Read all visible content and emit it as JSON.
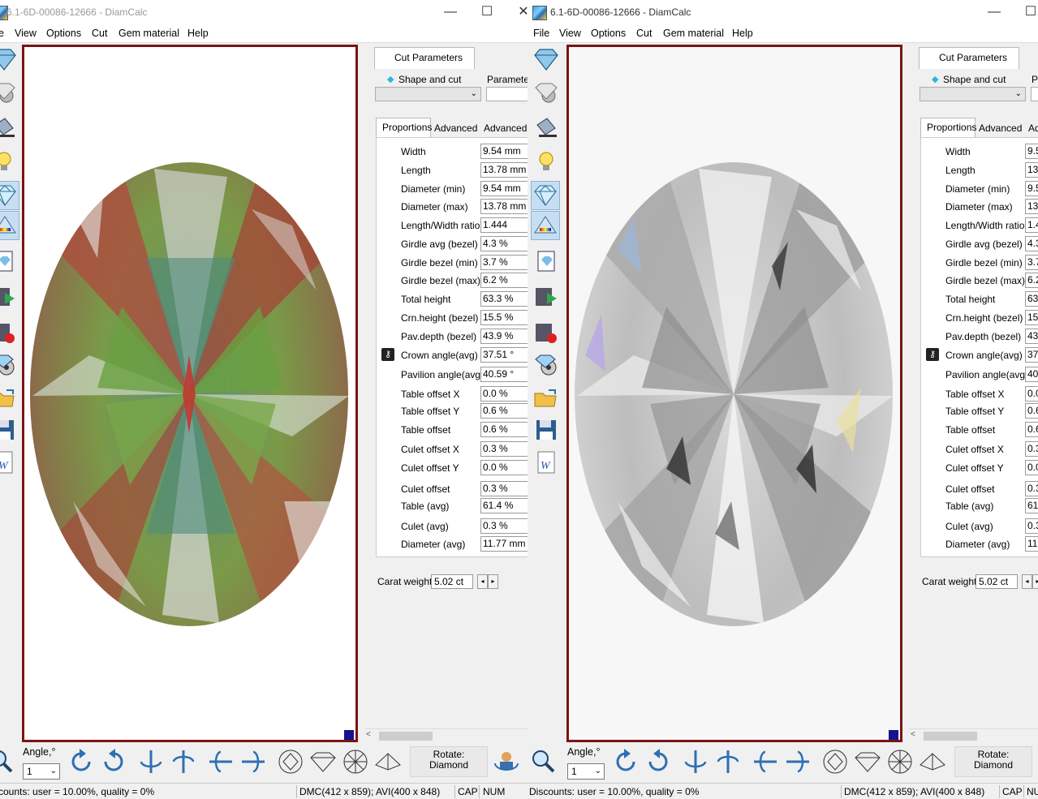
{
  "left_window": {
    "title": "6.1-6D-00086-12666 - DiamCalc",
    "menu": [
      "e",
      "View",
      "Options",
      "Cut",
      "Gem material",
      "Help"
    ],
    "panel": {
      "cut_parameters_tab": "Cut Parameters",
      "shape_and_cut_label": "Shape and cut",
      "parameters_label": "Parameter",
      "subtabs": [
        "Proportions",
        "Advanced",
        "Advanced"
      ],
      "rows": [
        {
          "label": "Width",
          "value": "9.54 mm"
        },
        {
          "label": "Length",
          "value": "13.78 mm"
        },
        {
          "label": "Diameter (min)",
          "value": "9.54 mm"
        },
        {
          "label": "Diameter (max)",
          "value": "13.78 mm"
        },
        {
          "label": "Length/Width ratio",
          "value": "1.444"
        },
        {
          "label": "Girdle avg (bezel)",
          "value": "4.3 %"
        },
        {
          "label": "Girdle bezel (min)",
          "value": "3.7 %"
        },
        {
          "label": "Girdle bezel (max)",
          "value": "6.2 %"
        },
        {
          "label": "Total height",
          "value": "63.3 %"
        },
        {
          "label": "Crn.height (bezel)",
          "value": "15.5 %"
        },
        {
          "label": "Pav.depth (bezel)",
          "value": "43.9 %"
        },
        {
          "label": "Crown angle(avg)",
          "value": "37.51 °"
        },
        {
          "label": "Pavilion angle(avg)",
          "value": "40.59 °"
        },
        {
          "label": "Table offset X",
          "value": "0.0 %"
        },
        {
          "label": "Table offset Y",
          "value": "0.6 %"
        },
        {
          "label": "Table offset",
          "value": "0.6 %"
        },
        {
          "label": "Culet offset X",
          "value": "0.3 %"
        },
        {
          "label": "Culet offset Y",
          "value": "0.0 %"
        },
        {
          "label": "Culet offset",
          "value": "0.3 %"
        },
        {
          "label": "Table (avg)",
          "value": "61.4 %"
        },
        {
          "label": "Culet (avg)",
          "value": "0.3 %"
        },
        {
          "label": "Diameter (avg)",
          "value": "11.77 mm"
        }
      ],
      "carat_label": "Carat weight",
      "carat_value": "5.02 ct"
    },
    "angle_label": "Angle,°",
    "angle_value": "1",
    "rotate_label": "Rotate:",
    "rotate_value": "Diamond",
    "status": {
      "discounts": "counts: user = 10.00%, quality = 0%",
      "dmc": "DMC(412 x 859); AVI(400 x 848)",
      "cap": "CAP",
      "num": "NUM"
    }
  },
  "right_window": {
    "title": "6.1-6D-00086-12666 - DiamCalc",
    "menu": [
      "File",
      "View",
      "Options",
      "Cut",
      "Gem material",
      "Help"
    ],
    "panel": {
      "cut_parameters_tab": "Cut Parameters",
      "shape_and_cut_label": "Shape and cut",
      "parameters_label": "P",
      "subtabs": [
        "Proportions",
        "Advanced",
        "Ad"
      ],
      "rows": [
        {
          "label": "Width",
          "value": "9.5"
        },
        {
          "label": "Length",
          "value": "13"
        },
        {
          "label": "Diameter (min)",
          "value": "9.5"
        },
        {
          "label": "Diameter (max)",
          "value": "13"
        },
        {
          "label": "Length/Width ratio",
          "value": "1.4"
        },
        {
          "label": "Girdle avg (bezel)",
          "value": "4.3"
        },
        {
          "label": "Girdle bezel (min)",
          "value": "3.7"
        },
        {
          "label": "Girdle bezel (max)",
          "value": "6.2"
        },
        {
          "label": "Total height",
          "value": "63"
        },
        {
          "label": "Crn.height (bezel)",
          "value": "15"
        },
        {
          "label": "Pav.depth (bezel)",
          "value": "43"
        },
        {
          "label": "Crown angle(avg)",
          "value": "37"
        },
        {
          "label": "Pavilion angle(avg)",
          "value": "40"
        },
        {
          "label": "Table offset X",
          "value": "0.0"
        },
        {
          "label": "Table offset Y",
          "value": "0.6"
        },
        {
          "label": "Table offset",
          "value": "0.6"
        },
        {
          "label": "Culet offset X",
          "value": "0.3"
        },
        {
          "label": "Culet offset Y",
          "value": "0.0"
        },
        {
          "label": "Culet offset",
          "value": "0.3"
        },
        {
          "label": "Table (avg)",
          "value": "61"
        },
        {
          "label": "Culet (avg)",
          "value": "0.3"
        },
        {
          "label": "Diameter (avg)",
          "value": "11"
        }
      ],
      "carat_label": "Carat weight",
      "carat_value": "5.02 ct"
    },
    "angle_label": "Angle,°",
    "angle_value": "1",
    "rotate_label": "Rotate:",
    "rotate_value": "Diamond",
    "status": {
      "discounts": "Discounts: user = 10.00%, quality = 0%",
      "dmc": "DMC(412 x 859); AVI(400 x 848)",
      "cap": "CAP",
      "num": "NU"
    }
  },
  "colors": {
    "viewport_border": "#7a1414",
    "corner_marker": "#14148c",
    "facet_green": "#6f9a3c",
    "facet_red": "#a8443a",
    "facet_grey": "#c8c8c8"
  }
}
